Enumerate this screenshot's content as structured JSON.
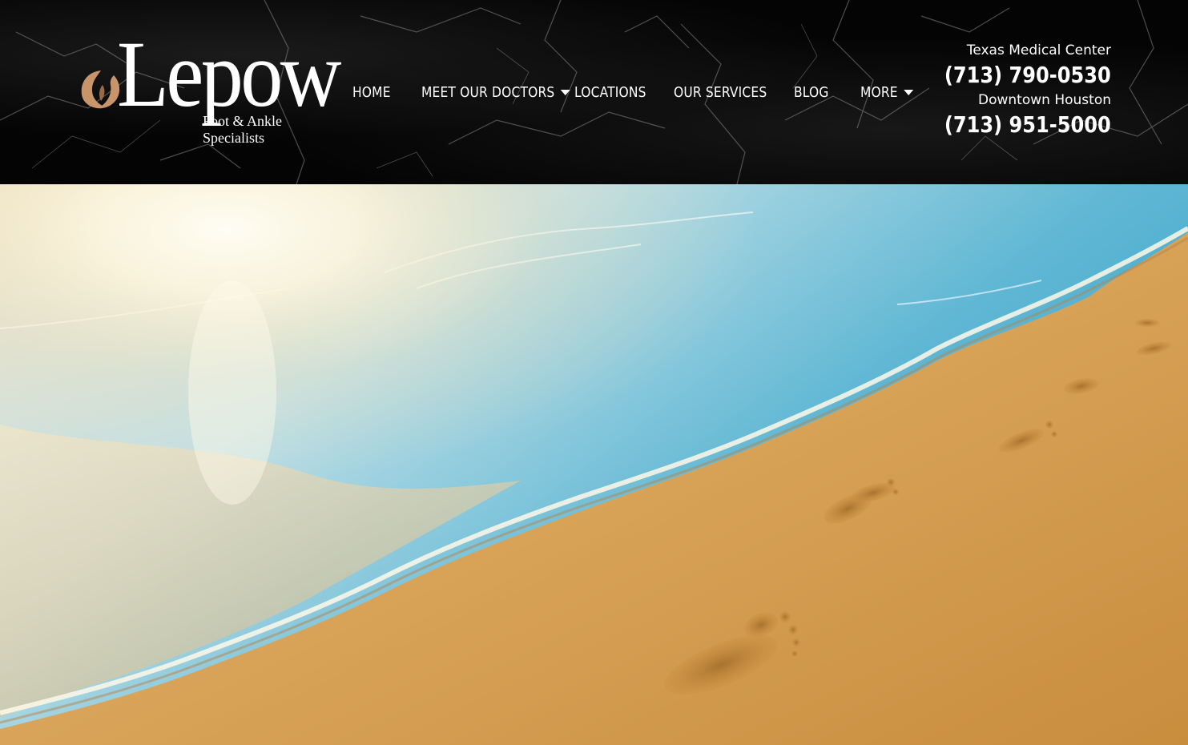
{
  "brand": {
    "name": "Lepow",
    "tagline_line1": "Foot & Ankle",
    "tagline_line2": "Specialists",
    "accent_color": "#c8946a"
  },
  "nav": {
    "items": [
      {
        "label": "HOME",
        "has_dropdown": false
      },
      {
        "label": "MEET OUR DOCTORS",
        "has_dropdown": true
      },
      {
        "label": "LOCATIONS",
        "has_dropdown": false
      },
      {
        "label": "OUR SERVICES",
        "has_dropdown": false
      },
      {
        "label": "BLOG",
        "has_dropdown": false
      },
      {
        "label": "MORE",
        "has_dropdown": true
      }
    ]
  },
  "contact": {
    "locations": [
      {
        "name": "Texas Medical Center",
        "phone": "(713) 790-0530"
      },
      {
        "name": "Downtown Houston",
        "phone": "(713) 951-5000"
      }
    ]
  },
  "hero": {
    "image": "beach-footprints-photo",
    "colors": {
      "sand": "#d9a459",
      "water": "#5fb7d4",
      "sun": "#fff6dc"
    }
  }
}
